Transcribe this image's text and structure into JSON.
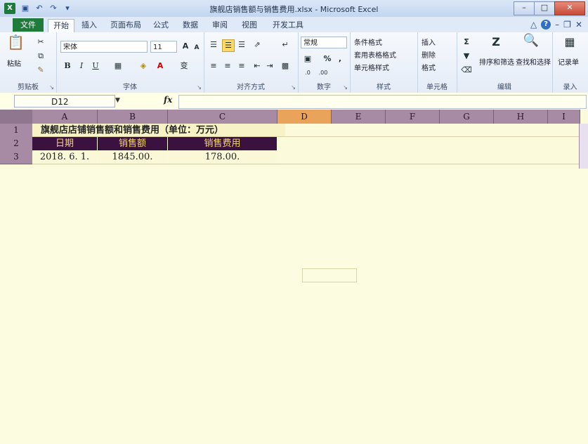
{
  "app": {
    "title": "旗舰店销售额与销售费用.xlsx - Microsoft Excel",
    "icon_letter": "X",
    "quick_access": [
      "save-icon",
      "undo-icon",
      "redo-icon",
      "customize-icon"
    ]
  },
  "window": {
    "minimize": "–",
    "maximize": "□",
    "close": "✕"
  },
  "tabs": {
    "file": "文件",
    "items": [
      "开始",
      "插入",
      "页面布局",
      "公式",
      "数据",
      "审阅",
      "视图",
      "开发工具"
    ],
    "active": "开始"
  },
  "ribbon": {
    "clipboard": {
      "label": "剪贴板",
      "paste": "粘贴"
    },
    "font": {
      "label": "字体",
      "name": "宋体",
      "size": "11",
      "bold": "B",
      "italic": "I",
      "underline": "U",
      "wen": "变"
    },
    "alignment": {
      "label": "对齐方式"
    },
    "number": {
      "label": "数字",
      "format": "常规",
      "percent": "%"
    },
    "styles": {
      "label": "样式",
      "conditional": "条件格式",
      "table": "套用表格格式",
      "cell": "单元格样式"
    },
    "cells": {
      "label": "单元格",
      "insert": "插入",
      "delete": "删除",
      "format": "格式"
    },
    "editing": {
      "label": "编辑",
      "sort": "排序和筛选",
      "find": "查找和选择"
    },
    "record": {
      "label": "录入",
      "btn": "记录单"
    }
  },
  "formula_bar": {
    "name_box": "D12",
    "fx": "fx",
    "value": ""
  },
  "columns": [
    "A",
    "B",
    "C",
    "D",
    "E",
    "F",
    "G",
    "H",
    "I"
  ],
  "selected_column": "D",
  "rows": [
    "1",
    "2",
    "3"
  ],
  "sheet": {
    "title": "旗舰店店铺销售额和销售费用（单位：万元）",
    "headers": [
      "日期",
      "销售额",
      "销售费用"
    ],
    "row3": [
      "2018. 6. 1.",
      "1845.00.",
      "178.00."
    ]
  },
  "colors": {
    "header_bg": "#3b1140",
    "header_text": "#f5d86a",
    "file_tab": "#1f7a3b",
    "selected_col": "#e9a35b"
  }
}
